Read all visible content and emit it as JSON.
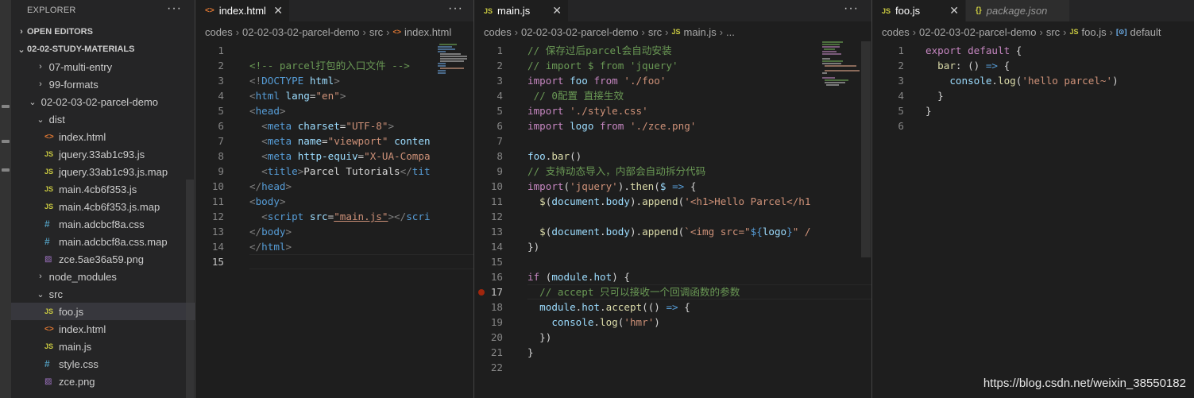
{
  "sidebar": {
    "title": "EXPLORER",
    "more": "···",
    "open_editors": "OPEN EDITORS",
    "root": "02-02-STUDY-MATERIALS",
    "items": [
      {
        "label": "07-multi-entry",
        "kind": "folder",
        "open": false,
        "depth": 1
      },
      {
        "label": "99-formats",
        "kind": "folder",
        "open": false,
        "depth": 1
      },
      {
        "label": "02-02-03-02-parcel-demo",
        "kind": "folder",
        "open": true,
        "depth": 0
      },
      {
        "label": "dist",
        "kind": "folder",
        "open": true,
        "depth": 1
      },
      {
        "label": "index.html",
        "kind": "html",
        "depth": 2
      },
      {
        "label": "jquery.33ab1c93.js",
        "kind": "js",
        "depth": 2
      },
      {
        "label": "jquery.33ab1c93.js.map",
        "kind": "js",
        "depth": 2
      },
      {
        "label": "main.4cb6f353.js",
        "kind": "js",
        "depth": 2
      },
      {
        "label": "main.4cb6f353.js.map",
        "kind": "js",
        "depth": 2
      },
      {
        "label": "main.adcbcf8a.css",
        "kind": "css",
        "depth": 2
      },
      {
        "label": "main.adcbcf8a.css.map",
        "kind": "css",
        "depth": 2
      },
      {
        "label": "zce.5ae36a59.png",
        "kind": "img",
        "depth": 2
      },
      {
        "label": "node_modules",
        "kind": "folder",
        "open": false,
        "depth": 1
      },
      {
        "label": "src",
        "kind": "folder",
        "open": true,
        "depth": 1
      },
      {
        "label": "foo.js",
        "kind": "js",
        "depth": 2,
        "selected": true
      },
      {
        "label": "index.html",
        "kind": "html",
        "depth": 2
      },
      {
        "label": "main.js",
        "kind": "js",
        "depth": 2
      },
      {
        "label": "style.css",
        "kind": "css",
        "depth": 2
      },
      {
        "label": "zce.png",
        "kind": "img",
        "depth": 2
      }
    ]
  },
  "icons": {
    "js": "JS",
    "html": "<>",
    "css": "#",
    "img": "▨",
    "json": "{}",
    "chevron_open": "⌄",
    "chevron_closed": "›",
    "close": "✕",
    "symbol": "[⊙]"
  },
  "colors": {
    "accent_tab": "#1e1e1e",
    "comment": "#6a9955",
    "keyword": "#c586c0",
    "tag": "#569cd6",
    "string": "#ce9178",
    "breakpoint": "#a1260d"
  },
  "editors": [
    {
      "id": "html",
      "tabs": [
        {
          "label": "index.html",
          "kind": "html",
          "active": true
        }
      ],
      "more": "···",
      "breadcrumb": [
        "codes",
        "02-02-03-02-parcel-demo",
        "src",
        "index.html"
      ],
      "breadcrumb_icon": "html",
      "active_line": 15,
      "lines": [
        [],
        [
          [
            "c",
            "<!-- parcel打包的入口文件 -->"
          ]
        ],
        [
          [
            "g",
            "<!"
          ],
          [
            "t",
            "DOCTYPE"
          ],
          [
            "p",
            " "
          ],
          [
            "a",
            "html"
          ],
          [
            "g",
            ">"
          ]
        ],
        [
          [
            "g",
            "<"
          ],
          [
            "t",
            "html"
          ],
          [
            "p",
            " "
          ],
          [
            "a",
            "lang"
          ],
          [
            "p",
            "="
          ],
          [
            "s",
            "\"en\""
          ],
          [
            "g",
            ">"
          ]
        ],
        [
          [
            "g",
            "<"
          ],
          [
            "t",
            "head"
          ],
          [
            "g",
            ">"
          ]
        ],
        [
          [
            "p",
            "  "
          ],
          [
            "g",
            "<"
          ],
          [
            "t",
            "meta"
          ],
          [
            "p",
            " "
          ],
          [
            "a",
            "charset"
          ],
          [
            "p",
            "="
          ],
          [
            "s",
            "\"UTF-8\""
          ],
          [
            "g",
            ">"
          ]
        ],
        [
          [
            "p",
            "  "
          ],
          [
            "g",
            "<"
          ],
          [
            "t",
            "meta"
          ],
          [
            "p",
            " "
          ],
          [
            "a",
            "name"
          ],
          [
            "p",
            "="
          ],
          [
            "s",
            "\"viewport\""
          ],
          [
            "p",
            " "
          ],
          [
            "a",
            "conten"
          ]
        ],
        [
          [
            "p",
            "  "
          ],
          [
            "g",
            "<"
          ],
          [
            "t",
            "meta"
          ],
          [
            "p",
            " "
          ],
          [
            "a",
            "http-equiv"
          ],
          [
            "p",
            "="
          ],
          [
            "s",
            "\"X-UA-Compa"
          ]
        ],
        [
          [
            "p",
            "  "
          ],
          [
            "g",
            "<"
          ],
          [
            "t",
            "title"
          ],
          [
            "g",
            ">"
          ],
          [
            "p",
            "Parcel Tutorials"
          ],
          [
            "g",
            "</"
          ],
          [
            "t",
            "tit"
          ]
        ],
        [
          [
            "g",
            "</"
          ],
          [
            "t",
            "head"
          ],
          [
            "g",
            ">"
          ]
        ],
        [
          [
            "g",
            "<"
          ],
          [
            "t",
            "body"
          ],
          [
            "g",
            ">"
          ]
        ],
        [
          [
            "p",
            "  "
          ],
          [
            "g",
            "<"
          ],
          [
            "t",
            "script"
          ],
          [
            "p",
            " "
          ],
          [
            "a",
            "src"
          ],
          [
            "p",
            "="
          ],
          [
            "su",
            "\"main.js\""
          ],
          [
            "g",
            "></"
          ],
          [
            "t",
            "scri"
          ]
        ],
        [
          [
            "g",
            "</"
          ],
          [
            "t",
            "body"
          ],
          [
            "g",
            ">"
          ]
        ],
        [
          [
            "g",
            "</"
          ],
          [
            "t",
            "html"
          ],
          [
            "g",
            ">"
          ]
        ],
        []
      ]
    },
    {
      "id": "mainjs",
      "tabs": [
        {
          "label": "main.js",
          "kind": "js",
          "active": true
        }
      ],
      "more": "···",
      "breadcrumb": [
        "codes",
        "02-02-03-02-parcel-demo",
        "src",
        "main.js",
        "..."
      ],
      "breadcrumb_icon": "js",
      "active_line": 17,
      "breakpoint_line": 17,
      "lines": [
        [
          [
            "c",
            "// 保存过后parcel会自动安装"
          ]
        ],
        [
          [
            "c",
            "// import $ from 'jquery'"
          ]
        ],
        [
          [
            "k",
            "import"
          ],
          [
            "p",
            " "
          ],
          [
            "a",
            "foo"
          ],
          [
            "p",
            " "
          ],
          [
            "k",
            "from"
          ],
          [
            "p",
            " "
          ],
          [
            "s",
            "'./foo'"
          ]
        ],
        [
          [
            "p",
            " "
          ],
          [
            "c",
            "// 0配置 直接生效"
          ]
        ],
        [
          [
            "k",
            "import"
          ],
          [
            "p",
            " "
          ],
          [
            "s",
            "'./style.css'"
          ]
        ],
        [
          [
            "k",
            "import"
          ],
          [
            "p",
            " "
          ],
          [
            "a",
            "logo"
          ],
          [
            "p",
            " "
          ],
          [
            "k",
            "from"
          ],
          [
            "p",
            " "
          ],
          [
            "s",
            "'./zce.png'"
          ]
        ],
        [],
        [
          [
            "a",
            "foo"
          ],
          [
            "p",
            "."
          ],
          [
            "f",
            "bar"
          ],
          [
            "p",
            "()"
          ]
        ],
        [
          [
            "c",
            "// 支持动态导入，内部会自动拆分代码"
          ]
        ],
        [
          [
            "k",
            "import"
          ],
          [
            "p",
            "("
          ],
          [
            "s",
            "'jquery'"
          ],
          [
            "p",
            ")."
          ],
          [
            "f",
            "then"
          ],
          [
            "p",
            "("
          ],
          [
            "a",
            "$"
          ],
          [
            "p",
            " "
          ],
          [
            "t",
            "=>"
          ],
          [
            "p",
            " {"
          ]
        ],
        [
          [
            "p",
            "  "
          ],
          [
            "f",
            "$"
          ],
          [
            "p",
            "("
          ],
          [
            "a",
            "document"
          ],
          [
            "p",
            "."
          ],
          [
            "a",
            "body"
          ],
          [
            "p",
            ")."
          ],
          [
            "f",
            "append"
          ],
          [
            "p",
            "("
          ],
          [
            "s",
            "'<h1>Hello Parcel</h1"
          ]
        ],
        [],
        [
          [
            "p",
            "  "
          ],
          [
            "f",
            "$"
          ],
          [
            "p",
            "("
          ],
          [
            "a",
            "document"
          ],
          [
            "p",
            "."
          ],
          [
            "a",
            "body"
          ],
          [
            "p",
            ")."
          ],
          [
            "f",
            "append"
          ],
          [
            "p",
            "("
          ],
          [
            "s",
            "`<img src=\""
          ],
          [
            "t",
            "${"
          ],
          [
            "a",
            "logo"
          ],
          [
            "t",
            "}"
          ],
          [
            "s",
            "\" /"
          ]
        ],
        [
          [
            "p",
            "})"
          ]
        ],
        [],
        [
          [
            "k",
            "if"
          ],
          [
            "p",
            " ("
          ],
          [
            "a",
            "module"
          ],
          [
            "p",
            "."
          ],
          [
            "a",
            "hot"
          ],
          [
            "p",
            ") {"
          ]
        ],
        [
          [
            "p",
            "  "
          ],
          [
            "c",
            "// accept 只可以接收一个回调函数的参数"
          ]
        ],
        [
          [
            "p",
            "  "
          ],
          [
            "a",
            "module"
          ],
          [
            "p",
            "."
          ],
          [
            "a",
            "hot"
          ],
          [
            "p",
            "."
          ],
          [
            "f",
            "accept"
          ],
          [
            "p",
            "(() "
          ],
          [
            "t",
            "=>"
          ],
          [
            "p",
            " {"
          ]
        ],
        [
          [
            "p",
            "    "
          ],
          [
            "a",
            "console"
          ],
          [
            "p",
            "."
          ],
          [
            "f",
            "log"
          ],
          [
            "p",
            "("
          ],
          [
            "s",
            "'hmr'"
          ],
          [
            "p",
            ")"
          ]
        ],
        [
          [
            "p",
            "  })"
          ]
        ],
        [
          [
            "p",
            "}"
          ]
        ],
        []
      ]
    },
    {
      "id": "foojs",
      "tabs": [
        {
          "label": "foo.js",
          "kind": "js",
          "active": true
        },
        {
          "label": "package.json",
          "kind": "json",
          "active": false
        }
      ],
      "breadcrumb": [
        "codes",
        "02-02-03-02-parcel-demo",
        "src",
        "foo.js",
        "default"
      ],
      "breadcrumb_icon": "js",
      "active_line": 0,
      "lines": [
        [
          [
            "k",
            "export"
          ],
          [
            "p",
            " "
          ],
          [
            "k",
            "default"
          ],
          [
            "p",
            " {"
          ]
        ],
        [
          [
            "p",
            "  "
          ],
          [
            "f",
            "bar"
          ],
          [
            "p",
            ": () "
          ],
          [
            "t",
            "=>"
          ],
          [
            "p",
            " {"
          ]
        ],
        [
          [
            "p",
            "    "
          ],
          [
            "a",
            "console"
          ],
          [
            "p",
            "."
          ],
          [
            "f",
            "log"
          ],
          [
            "p",
            "("
          ],
          [
            "s",
            "'hello parcel~'"
          ],
          [
            "p",
            ")"
          ]
        ],
        [
          [
            "p",
            "  }"
          ]
        ],
        [
          [
            "p",
            "}"
          ]
        ],
        []
      ]
    }
  ],
  "watermark": "https://blog.csdn.net/weixin_38550182"
}
